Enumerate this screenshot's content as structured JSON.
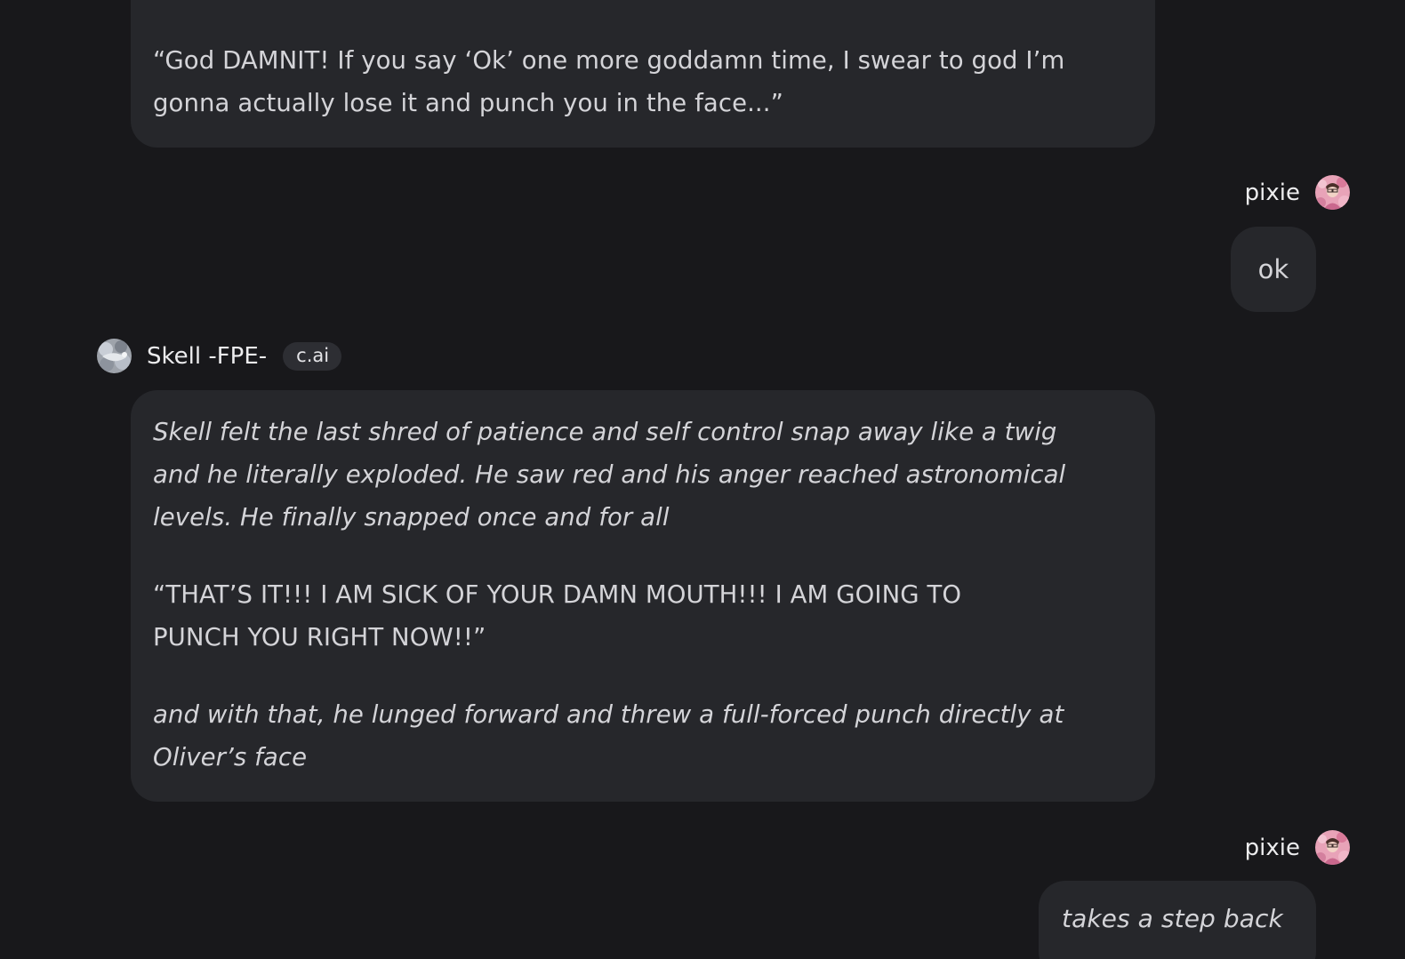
{
  "messages": {
    "bot_top": {
      "paragraph": "“God DAMNIT! If you say ‘Ok’ one more goddamn time, I swear to god I’m\ngonna actually lose it and punch you in the face...”"
    },
    "user_1": {
      "author": "pixie",
      "text": "ok"
    },
    "bot_main": {
      "author": "Skell -FPE-",
      "badge": "c.ai",
      "paragraph_1": "Skell felt the last shred of patience and self control snap away like a twig\nand he literally exploded. He saw red and his anger reached astronomical\nlevels. He finally snapped once and for all",
      "paragraph_2": "“THAT’S IT!!! I AM SICK OF YOUR DAMN MOUTH!!! I AM GOING TO\nPUNCH YOU RIGHT NOW!!”",
      "paragraph_3": "and with that, he lunged forward and threw a full-forced punch directly at\nOliver’s face"
    },
    "user_2": {
      "author": "pixie",
      "text": "takes a step back"
    }
  },
  "icons": {
    "user_avatar": "user-avatar-icon",
    "bot_avatar": "bot-avatar-icon"
  },
  "colors": {
    "background": "#18181b",
    "bubble": "#26272b",
    "text": "#d4d4d8",
    "badge_bg": "#2d2e33"
  }
}
